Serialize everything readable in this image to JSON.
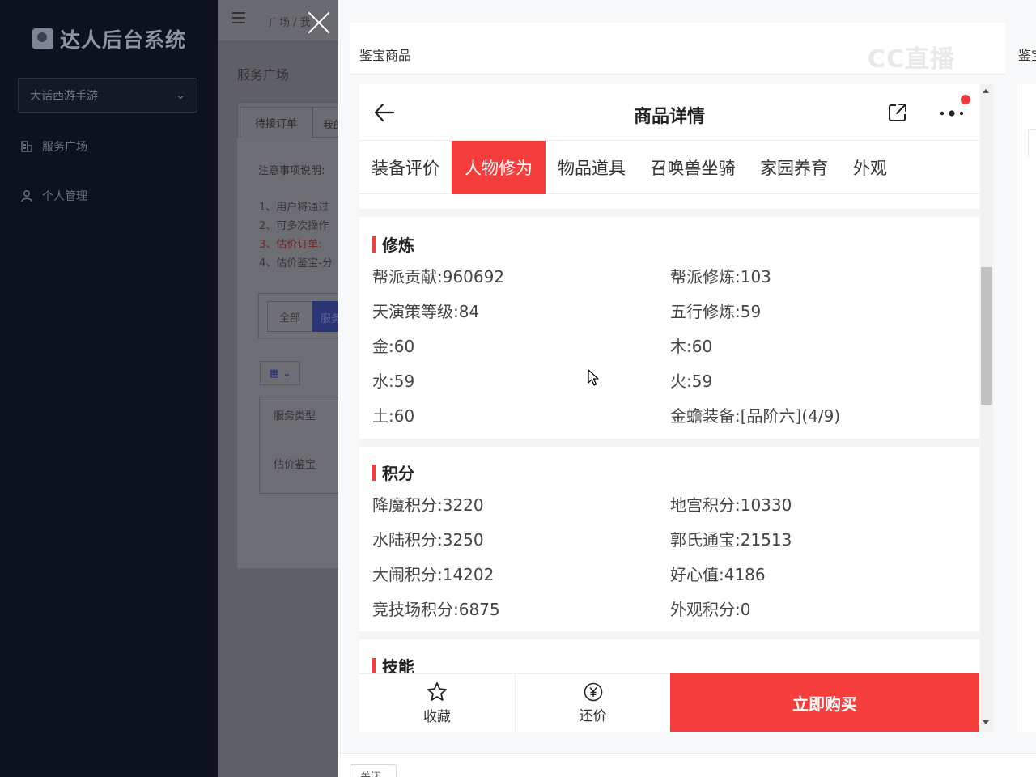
{
  "sidebar": {
    "logo_text": "达人后台系统",
    "game_select": "大话西游手游",
    "items": [
      {
        "label": "服务广场"
      },
      {
        "label": "个人管理"
      }
    ]
  },
  "background": {
    "breadcrumb": "广场 / 我",
    "page_title": "服务广场",
    "tabs": [
      "待接订单",
      "我的"
    ],
    "note_title": "注意事项说明:",
    "notes": [
      "1、用户将通过",
      "2、可多次操作",
      "3、估价订单:",
      "4、估价鉴宝-分"
    ],
    "filter_all": "全部",
    "filter_service": "服务",
    "table_header": "服务类型",
    "table_cell": "估价鉴宝"
  },
  "drawer": {
    "title": "鉴宝商品",
    "watermark": "CC直播",
    "right_title": "鉴宝",
    "close_label": "关闭"
  },
  "product": {
    "nav_title": "商品详情",
    "tabs": [
      "装备评价",
      "人物修为",
      "物品道具",
      "召唤兽坐骑",
      "家园养育",
      "外观"
    ],
    "active_tab": "人物修为",
    "sections": [
      {
        "title": "修炼",
        "rows": [
          [
            "帮派贡献:960692",
            "帮派修炼:103"
          ],
          [
            "天演策等级:84",
            "五行修炼:59"
          ],
          [
            "金:60",
            "木:60"
          ],
          [
            "水:59",
            "火:59"
          ],
          [
            "土:60",
            "金蟾装备:[品阶六](4/9)"
          ]
        ]
      },
      {
        "title": "积分",
        "rows": [
          [
            "降魔积分:3220",
            "地宫积分:10330"
          ],
          [
            "水陆积分:3250",
            "郭氏通宝:21513"
          ],
          [
            "大闹积分:14202",
            "好心值:4186"
          ],
          [
            "竞技场积分:6875",
            "外观积分:0"
          ]
        ]
      },
      {
        "title": "技能",
        "rows": []
      }
    ],
    "bottom": {
      "favorite": "收藏",
      "bargain": "还价",
      "buy": "立即购买"
    }
  },
  "colors": {
    "accent": "#f53d3b",
    "sidebar_bg": "#0e1220",
    "overlay": "#5f6066"
  }
}
